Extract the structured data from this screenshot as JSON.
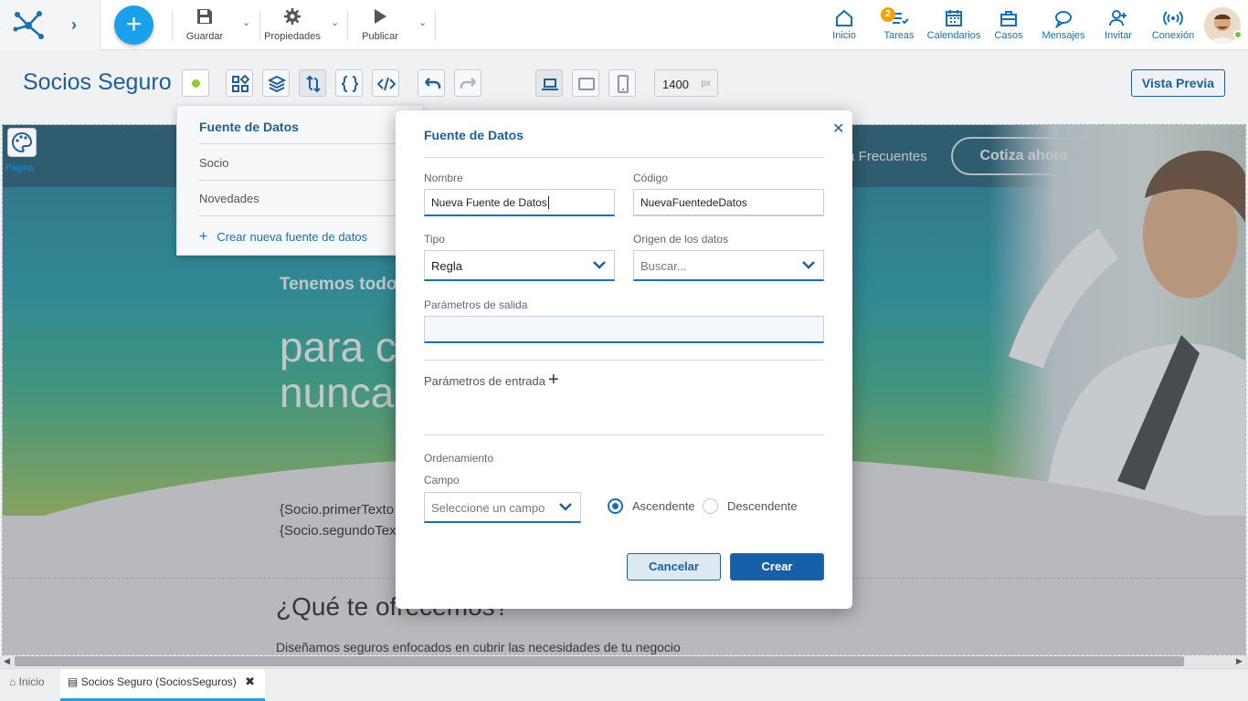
{
  "topbar": {
    "save": "Guardar",
    "properties": "Propiedades",
    "publish": "Publicar",
    "nav": [
      {
        "label": "Inicio",
        "icon": "home-icon"
      },
      {
        "label": "Tareas",
        "icon": "tasks-icon",
        "badge": "2"
      },
      {
        "label": "Calendarios",
        "icon": "calendar-icon"
      },
      {
        "label": "Casos",
        "icon": "briefcase-icon"
      },
      {
        "label": "Mensajes",
        "icon": "chat-icon"
      },
      {
        "label": "Invitar",
        "icon": "add-user-icon"
      },
      {
        "label": "Conexión",
        "icon": "broadcast-icon"
      }
    ]
  },
  "editor": {
    "title": "Socios Seguro",
    "width_value": "1400",
    "width_unit": "px",
    "preview": "Vista Previa"
  },
  "canvas": {
    "palette_label": "Página",
    "nav_faq": "ta Frecuentes",
    "cta": "Cotiza ahora",
    "hero_line1": "Tenemos todo",
    "hero_line2a": "para c",
    "hero_line2b": "nunca",
    "socio1": "{Socio.primerTexto",
    "socio2": "{Socio.segundoTex",
    "section_title": "¿Qué te ofrecemos?",
    "section_text": "Diseñamos seguros enfocados en cubrir las necesidades de tu negocio"
  },
  "dropdown": {
    "header": "Fuente de Datos",
    "items": [
      "Socio",
      "Novedades"
    ],
    "create": "Crear nueva fuente de datos"
  },
  "modal": {
    "title": "Fuente de Datos",
    "name_label": "Nombre",
    "name_value": "Nueva Fuente de Datos",
    "code_label": "Código",
    "code_value": "NuevaFuentedeDatos",
    "type_label": "Tipo",
    "type_value": "Regla",
    "origin_label": "Origen de los datos",
    "origin_placeholder": "Buscar...",
    "output_label": "Parámetros de salida",
    "input_params_label": "Parámetros de entrada",
    "order_label": "Ordenamiento",
    "field_label": "Campo",
    "field_placeholder": "Seleccione un campo",
    "asc": "Ascendente",
    "desc": "Descendente",
    "cancel": "Cancelar",
    "create": "Crear"
  },
  "tabs": [
    {
      "label": "Inicio"
    },
    {
      "label": "Socios Seguro (SociosSeguros)"
    }
  ],
  "colors": {
    "accent": "#1ba1ea",
    "primary": "#1f5f95",
    "status_dot": "#9ac43c"
  }
}
